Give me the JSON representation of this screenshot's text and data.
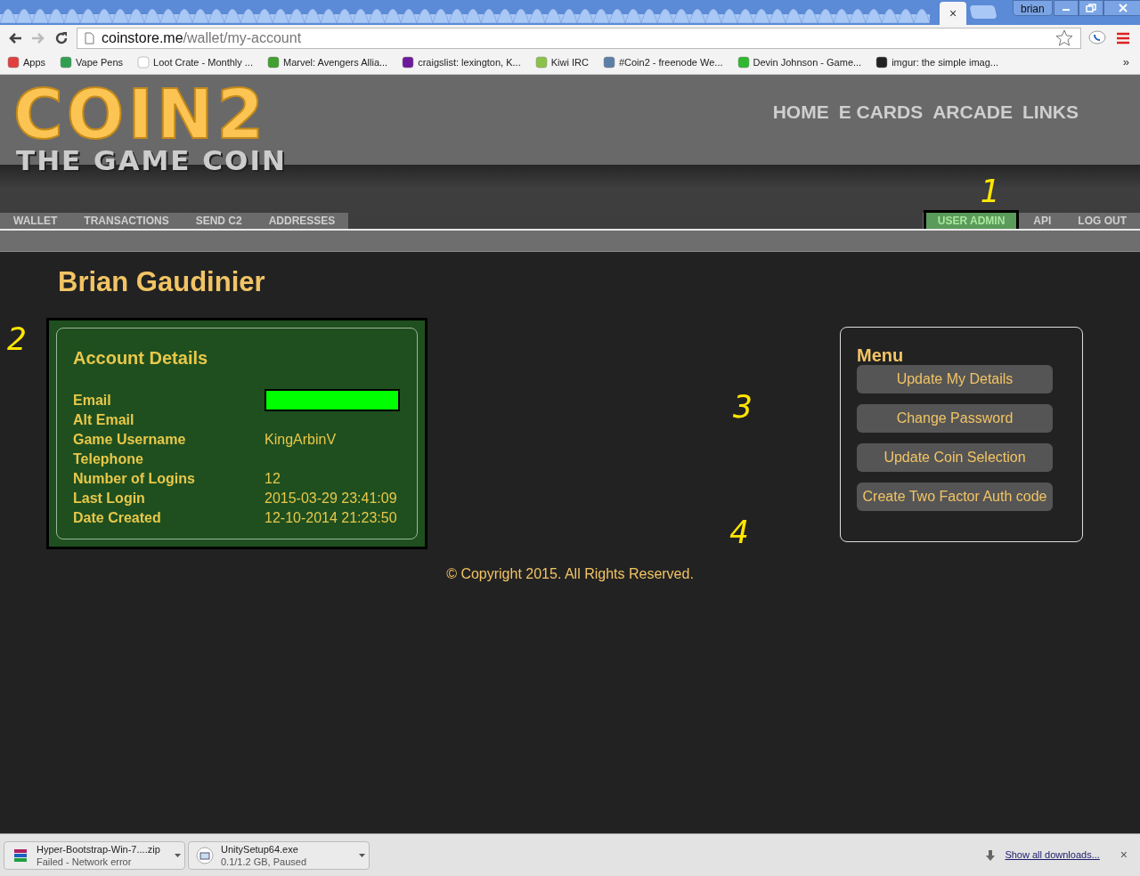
{
  "browser": {
    "tab_close": "×",
    "profile": "brian",
    "url": {
      "host": "coinstore.me",
      "path": "/wallet/my-account"
    },
    "bookmarks": [
      {
        "label": "Apps",
        "color": "#e04040"
      },
      {
        "label": "Vape Pens",
        "color": "#30a050"
      },
      {
        "label": "Loot Crate - Monthly ...",
        "color": "#ffffff"
      },
      {
        "label": "Marvel: Avengers Allia...",
        "color": "#40a030"
      },
      {
        "label": "craigslist: lexington, K...",
        "color": "#6a1b9a"
      },
      {
        "label": "Kiwi IRC",
        "color": "#8bc34a"
      },
      {
        "label": "#Coin2 - freenode We...",
        "color": "#5c7fa8"
      },
      {
        "label": "Devin Johnson - Game...",
        "color": "#2eb82e"
      },
      {
        "label": "imgur: the simple imag...",
        "color": "#222222"
      }
    ],
    "more": "»"
  },
  "site": {
    "logo": {
      "title": "COIN2",
      "subtitle": "THE GAME COIN"
    },
    "top_nav": [
      "HOME",
      "E CARDS",
      "ARCADE",
      "LINKS"
    ],
    "tabs_left": [
      {
        "label": "WALLET",
        "selected": false
      },
      {
        "label": "TRANSACTIONS",
        "selected": false
      },
      {
        "label": "SEND C2",
        "selected": false
      },
      {
        "label": "ADDRESSES",
        "selected": false
      }
    ],
    "tabs_right": [
      {
        "label": "USER ADMIN",
        "selected": true
      },
      {
        "label": "API",
        "selected": false
      },
      {
        "label": "LOG OUT",
        "selected": false
      }
    ],
    "annotations": [
      "1",
      "2",
      "3",
      "4"
    ],
    "user_name": "Brian Gaudinier",
    "account": {
      "title": "Account Details",
      "fields": [
        {
          "label": "Email",
          "kind": "redacted"
        },
        {
          "label": "Alt Email",
          "kind": "empty"
        },
        {
          "label": "Game Username",
          "kind": "text",
          "value": "KingArbinV"
        },
        {
          "label": "Telephone",
          "kind": "empty"
        },
        {
          "label": "Number of Logins",
          "kind": "text",
          "value": "12"
        },
        {
          "label": "Last Login",
          "kind": "text",
          "value": "2015-03-29 23:41:09"
        },
        {
          "label": "Date Created",
          "kind": "text",
          "value": "12-10-2014 21:23:50"
        }
      ]
    },
    "menu": {
      "title": "Menu",
      "buttons": [
        "Update My Details",
        "Change Password",
        "Update Coin Selection",
        "Create Two Factor Auth code"
      ]
    },
    "copyright": "© Copyright 2015. All Rights Reserved."
  },
  "downloads": {
    "items": [
      {
        "name": "Hyper-Bootstrap-Win-7....zip",
        "status": "Failed - Network error",
        "kind": "archive"
      },
      {
        "name": "UnitySetup64.exe",
        "status": "0.1/1.2 GB, Paused",
        "kind": "installer"
      }
    ],
    "show_all": "Show all downloads...",
    "close": "×"
  }
}
